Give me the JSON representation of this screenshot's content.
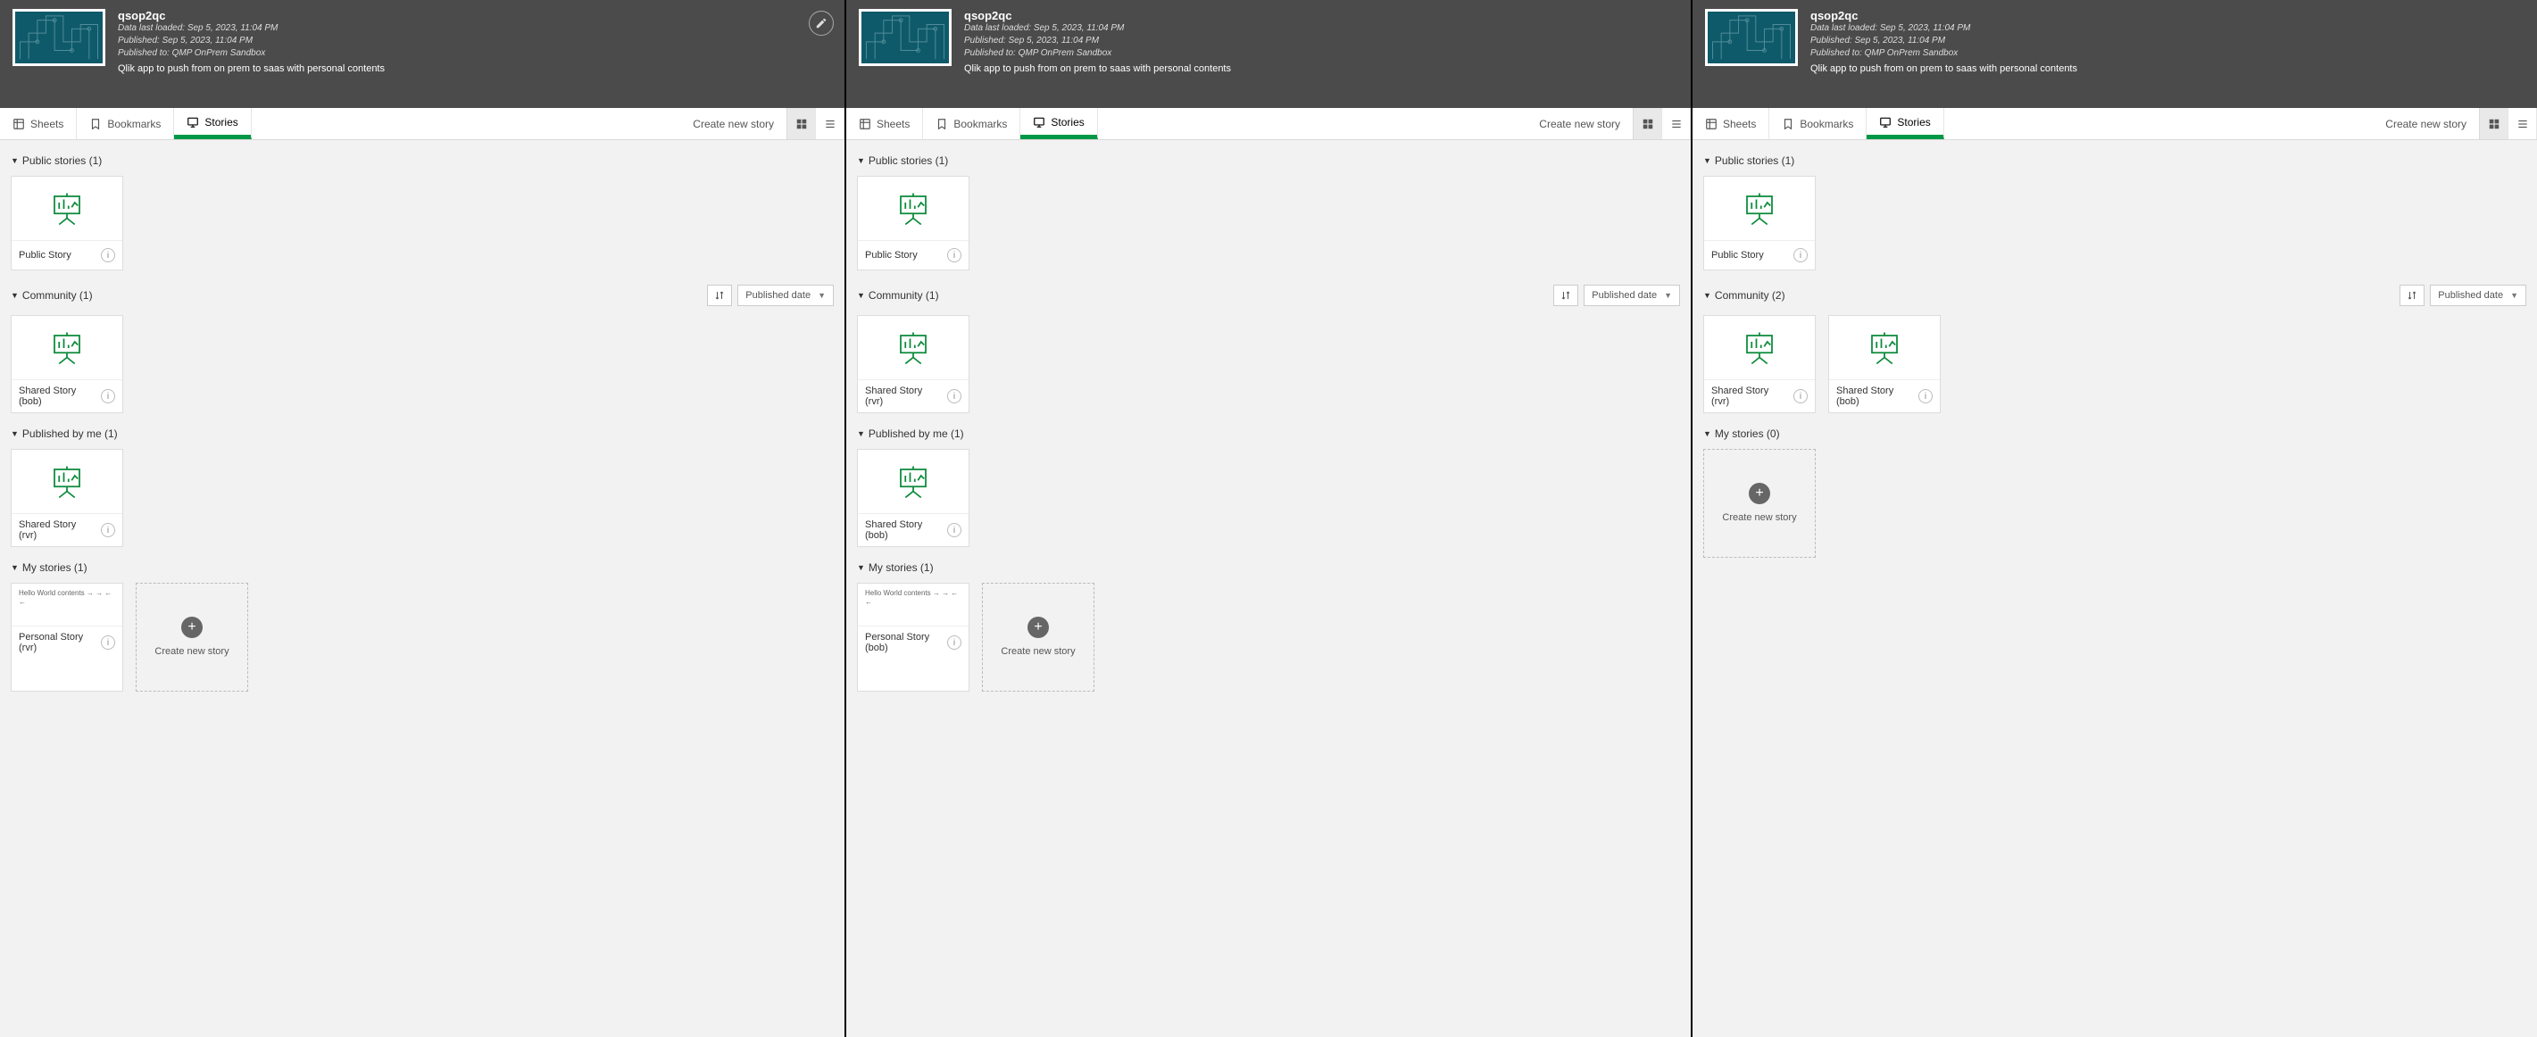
{
  "app": {
    "title": "qsop2qc",
    "meta_loaded": "Data last loaded: Sep 5, 2023, 11:04 PM",
    "meta_published": "Published: Sep 5, 2023, 11:04 PM",
    "meta_pubto": "Published to: QMP OnPrem Sandbox",
    "description": "Qlik app to push from on prem to saas with personal contents"
  },
  "tabs": {
    "sheets": "Sheets",
    "bookmarks": "Bookmarks",
    "stories": "Stories"
  },
  "actions": {
    "create_new_story": "Create new story",
    "create_new_story_card": "Create new\nstory",
    "published_date": "Published date"
  },
  "panels": [
    {
      "show_edit": true,
      "sections": [
        {
          "title": "Public stories (1)",
          "has_sort": false,
          "cards": [
            {
              "kind": "easel",
              "title": "Public Story"
            }
          ]
        },
        {
          "title": "Community (1)",
          "has_sort": true,
          "cards": [
            {
              "kind": "easel",
              "title": "Shared Story (bob)"
            }
          ]
        },
        {
          "title": "Published by me (1)",
          "has_sort": false,
          "cards": [
            {
              "kind": "easel",
              "title": "Shared Story (rvr)"
            }
          ]
        },
        {
          "title": "My stories (1)",
          "has_sort": false,
          "cards": [
            {
              "kind": "text",
              "title": "Personal Story (rvr)",
              "text": "Hello World\ncontents → →\n← ←"
            },
            {
              "kind": "new"
            }
          ]
        }
      ]
    },
    {
      "show_edit": false,
      "sections": [
        {
          "title": "Public stories (1)",
          "has_sort": false,
          "cards": [
            {
              "kind": "easel",
              "title": "Public Story"
            }
          ]
        },
        {
          "title": "Community (1)",
          "has_sort": true,
          "cards": [
            {
              "kind": "easel",
              "title": "Shared Story (rvr)"
            }
          ]
        },
        {
          "title": "Published by me (1)",
          "has_sort": false,
          "cards": [
            {
              "kind": "easel",
              "title": "Shared Story (bob)"
            }
          ]
        },
        {
          "title": "My stories (1)",
          "has_sort": false,
          "cards": [
            {
              "kind": "text",
              "title": "Personal Story (bob)",
              "text": "Hello World\ncontents → →\n← ←"
            },
            {
              "kind": "new"
            }
          ]
        }
      ]
    },
    {
      "show_edit": false,
      "sections": [
        {
          "title": "Public stories (1)",
          "has_sort": false,
          "cards": [
            {
              "kind": "easel",
              "title": "Public Story"
            }
          ]
        },
        {
          "title": "Community (2)",
          "has_sort": true,
          "cards": [
            {
              "kind": "easel",
              "title": "Shared Story (rvr)"
            },
            {
              "kind": "easel",
              "title": "Shared Story (bob)"
            }
          ]
        },
        {
          "title": "My stories (0)",
          "has_sort": false,
          "cards": [
            {
              "kind": "new"
            }
          ]
        }
      ]
    }
  ]
}
